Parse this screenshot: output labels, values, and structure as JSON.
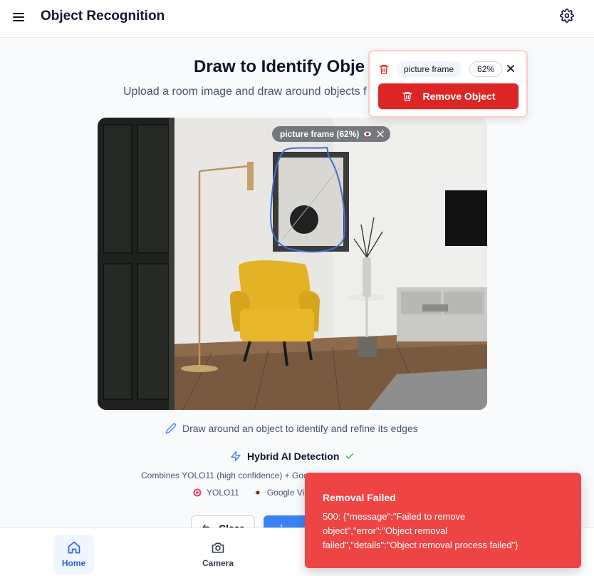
{
  "header": {
    "title": "Object Recognition",
    "menu_icon": "hamburger-menu-icon",
    "settings_icon": "gear-icon"
  },
  "main": {
    "title": "Draw to Identify Obje",
    "subtitle": "Upload a room image and draw around objects f",
    "detection_badge": "picture frame (62%)",
    "hint": "Draw around an object to identify and refine its edges",
    "hybrid_title": "Hybrid AI Detection",
    "combines_text": "Combines YOLO11 (high confidence) + Goo",
    "models": [
      {
        "icon": "target-icon",
        "label": "YOLO11"
      },
      {
        "icon": "eye-icon",
        "label": "Google Visi"
      }
    ]
  },
  "actions": {
    "clear_label": "Clear"
  },
  "popover": {
    "label": "picture frame",
    "confidence": "62%",
    "remove_label": "Remove Object"
  },
  "toast": {
    "title": "Removal Failed",
    "message": "500: {\"message\":\"Failed to remove object\",\"error\":\"Object removal failed\",\"details\":\"Object removal process failed\"}"
  },
  "nav": {
    "home_label": "Home",
    "camera_label": "Camera"
  },
  "colors": {
    "primary": "#3b82f6",
    "danger": "#dc2626",
    "toast": "#ef4444",
    "success": "#22c55e"
  }
}
